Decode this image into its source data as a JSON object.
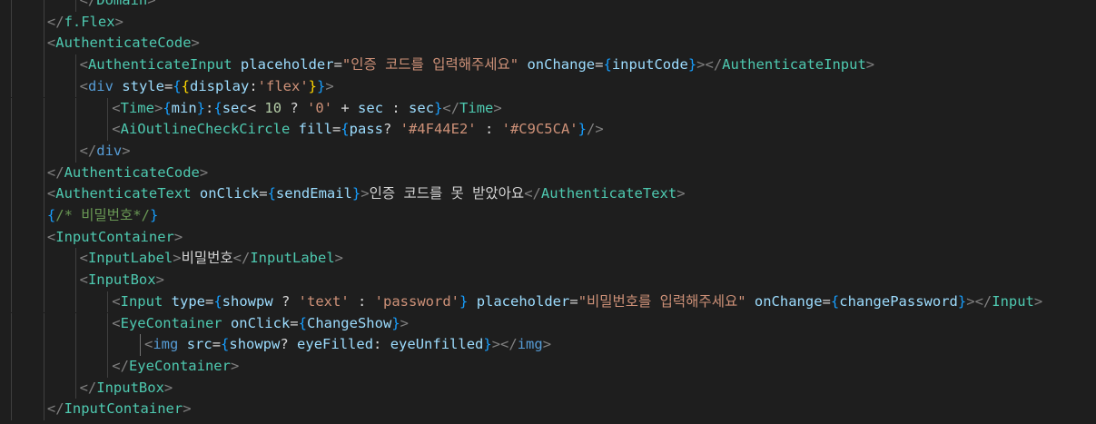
{
  "editor": {
    "language": "jsx",
    "lines": [
      {
        "indent": 3,
        "tokens": [
          {
            "c": "t-tag",
            "t": "</"
          },
          {
            "c": "t-comp",
            "t": "Domain"
          },
          {
            "c": "t-tag",
            "t": ">"
          }
        ]
      },
      {
        "indent": 2,
        "tokens": [
          {
            "c": "t-tag",
            "t": "</"
          },
          {
            "c": "t-comp",
            "t": "f.Flex"
          },
          {
            "c": "t-tag",
            "t": ">"
          }
        ]
      },
      {
        "indent": 2,
        "tokens": [
          {
            "c": "t-tag",
            "t": "<"
          },
          {
            "c": "t-comp",
            "t": "AuthenticateCode"
          },
          {
            "c": "t-tag",
            "t": ">"
          }
        ]
      },
      {
        "indent": 3,
        "tokens": [
          {
            "c": "t-tag",
            "t": "<"
          },
          {
            "c": "t-comp",
            "t": "AuthenticateInput"
          },
          {
            "c": "t-op",
            "t": " "
          },
          {
            "c": "t-attr",
            "t": "placeholder"
          },
          {
            "c": "t-op",
            "t": "="
          },
          {
            "c": "t-str",
            "t": "\"인증 코드를 입력해주세요\""
          },
          {
            "c": "t-op",
            "t": " "
          },
          {
            "c": "t-attr",
            "t": "onChange"
          },
          {
            "c": "t-op",
            "t": "="
          },
          {
            "c": "t-brace",
            "t": "{"
          },
          {
            "c": "t-var",
            "t": "inputCode"
          },
          {
            "c": "t-brace",
            "t": "}"
          },
          {
            "c": "t-tag",
            "t": "></"
          },
          {
            "c": "t-comp",
            "t": "AuthenticateInput"
          },
          {
            "c": "t-tag",
            "t": ">"
          }
        ]
      },
      {
        "indent": 3,
        "tokens": [
          {
            "c": "t-tag",
            "t": "<"
          },
          {
            "c": "t-html",
            "t": "div"
          },
          {
            "c": "t-op",
            "t": " "
          },
          {
            "c": "t-attr",
            "t": "style"
          },
          {
            "c": "t-op",
            "t": "="
          },
          {
            "c": "t-brace",
            "t": "{"
          },
          {
            "c": "t-brace3",
            "t": "{"
          },
          {
            "c": "t-attr",
            "t": "display"
          },
          {
            "c": "t-op",
            "t": ":"
          },
          {
            "c": "t-str",
            "t": "'flex'"
          },
          {
            "c": "t-brace3",
            "t": "}"
          },
          {
            "c": "t-brace",
            "t": "}"
          },
          {
            "c": "t-tag",
            "t": ">"
          }
        ]
      },
      {
        "indent": 4,
        "tokens": [
          {
            "c": "t-tag",
            "t": "<"
          },
          {
            "c": "t-comp",
            "t": "Time"
          },
          {
            "c": "t-tag",
            "t": ">"
          },
          {
            "c": "t-brace",
            "t": "{"
          },
          {
            "c": "t-var",
            "t": "min"
          },
          {
            "c": "t-brace",
            "t": "}"
          },
          {
            "c": "t-text",
            "t": ":"
          },
          {
            "c": "t-brace",
            "t": "{"
          },
          {
            "c": "t-var",
            "t": "sec"
          },
          {
            "c": "t-op",
            "t": "< "
          },
          {
            "c": "t-num",
            "t": "10"
          },
          {
            "c": "t-op",
            "t": " ? "
          },
          {
            "c": "t-str",
            "t": "'0'"
          },
          {
            "c": "t-op",
            "t": " + "
          },
          {
            "c": "t-var",
            "t": "sec"
          },
          {
            "c": "t-op",
            "t": " : "
          },
          {
            "c": "t-var",
            "t": "sec"
          },
          {
            "c": "t-brace",
            "t": "}"
          },
          {
            "c": "t-tag",
            "t": "</"
          },
          {
            "c": "t-comp",
            "t": "Time"
          },
          {
            "c": "t-tag",
            "t": ">"
          }
        ]
      },
      {
        "indent": 4,
        "tokens": [
          {
            "c": "t-tag",
            "t": "<"
          },
          {
            "c": "t-comp",
            "t": "AiOutlineCheckCircle"
          },
          {
            "c": "t-op",
            "t": " "
          },
          {
            "c": "t-attr",
            "t": "fill"
          },
          {
            "c": "t-op",
            "t": "="
          },
          {
            "c": "t-brace",
            "t": "{"
          },
          {
            "c": "t-var",
            "t": "pass"
          },
          {
            "c": "t-op",
            "t": "? "
          },
          {
            "c": "t-str",
            "t": "'#4F44E2'"
          },
          {
            "c": "t-op",
            "t": " : "
          },
          {
            "c": "t-str",
            "t": "'#C9C5CA'"
          },
          {
            "c": "t-brace",
            "t": "}"
          },
          {
            "c": "t-tag",
            "t": "/>"
          }
        ]
      },
      {
        "indent": 3,
        "tokens": [
          {
            "c": "t-tag",
            "t": "</"
          },
          {
            "c": "t-html",
            "t": "div"
          },
          {
            "c": "t-tag",
            "t": ">"
          }
        ]
      },
      {
        "indent": 2,
        "tokens": [
          {
            "c": "t-tag",
            "t": "</"
          },
          {
            "c": "t-comp",
            "t": "AuthenticateCode"
          },
          {
            "c": "t-tag",
            "t": ">"
          }
        ]
      },
      {
        "indent": 2,
        "tokens": [
          {
            "c": "t-tag",
            "t": "<"
          },
          {
            "c": "t-comp",
            "t": "AuthenticateText"
          },
          {
            "c": "t-op",
            "t": " "
          },
          {
            "c": "t-attr",
            "t": "onClick"
          },
          {
            "c": "t-op",
            "t": "="
          },
          {
            "c": "t-brace",
            "t": "{"
          },
          {
            "c": "t-var",
            "t": "sendEmail"
          },
          {
            "c": "t-brace",
            "t": "}"
          },
          {
            "c": "t-tag",
            "t": ">"
          },
          {
            "c": "t-text",
            "t": "인증 코드를 못 받았아요"
          },
          {
            "c": "t-tag",
            "t": "</"
          },
          {
            "c": "t-comp",
            "t": "AuthenticateText"
          },
          {
            "c": "t-tag",
            "t": ">"
          }
        ]
      },
      {
        "indent": 2,
        "tokens": [
          {
            "c": "t-brace",
            "t": "{"
          },
          {
            "c": "t-comment",
            "t": "/* 비밀번호*/"
          },
          {
            "c": "t-brace",
            "t": "}"
          }
        ]
      },
      {
        "indent": 2,
        "tokens": [
          {
            "c": "t-tag",
            "t": "<"
          },
          {
            "c": "t-comp",
            "t": "InputContainer"
          },
          {
            "c": "t-tag",
            "t": ">"
          }
        ]
      },
      {
        "indent": 3,
        "tokens": [
          {
            "c": "t-tag",
            "t": "<"
          },
          {
            "c": "t-comp",
            "t": "InputLabel"
          },
          {
            "c": "t-tag",
            "t": ">"
          },
          {
            "c": "t-text",
            "t": "비밀번호"
          },
          {
            "c": "t-tag",
            "t": "</"
          },
          {
            "c": "t-comp",
            "t": "InputLabel"
          },
          {
            "c": "t-tag",
            "t": ">"
          }
        ]
      },
      {
        "indent": 3,
        "tokens": [
          {
            "c": "t-tag",
            "t": "<"
          },
          {
            "c": "t-comp",
            "t": "InputBox"
          },
          {
            "c": "t-tag",
            "t": ">"
          }
        ]
      },
      {
        "indent": 4,
        "tokens": [
          {
            "c": "t-tag",
            "t": "<"
          },
          {
            "c": "t-comp",
            "t": "Input"
          },
          {
            "c": "t-op",
            "t": " "
          },
          {
            "c": "t-attr",
            "t": "type"
          },
          {
            "c": "t-op",
            "t": "="
          },
          {
            "c": "t-brace",
            "t": "{"
          },
          {
            "c": "t-var",
            "t": "showpw"
          },
          {
            "c": "t-op",
            "t": " ? "
          },
          {
            "c": "t-str",
            "t": "'text'"
          },
          {
            "c": "t-op",
            "t": " : "
          },
          {
            "c": "t-str",
            "t": "'password'"
          },
          {
            "c": "t-brace",
            "t": "}"
          },
          {
            "c": "t-op",
            "t": " "
          },
          {
            "c": "t-attr",
            "t": "placeholder"
          },
          {
            "c": "t-op",
            "t": "="
          },
          {
            "c": "t-str",
            "t": "\"비밀번호를 입력해주세요\""
          },
          {
            "c": "t-op",
            "t": " "
          },
          {
            "c": "t-attr",
            "t": "onChange"
          },
          {
            "c": "t-op",
            "t": "="
          },
          {
            "c": "t-brace",
            "t": "{"
          },
          {
            "c": "t-var",
            "t": "changePassword"
          },
          {
            "c": "t-brace",
            "t": "}"
          },
          {
            "c": "t-tag",
            "t": "></"
          },
          {
            "c": "t-comp",
            "t": "Input"
          },
          {
            "c": "t-tag",
            "t": ">"
          }
        ]
      },
      {
        "indent": 4,
        "tokens": [
          {
            "c": "t-tag",
            "t": "<"
          },
          {
            "c": "t-comp",
            "t": "EyeContainer"
          },
          {
            "c": "t-op",
            "t": " "
          },
          {
            "c": "t-attr",
            "t": "onClick"
          },
          {
            "c": "t-op",
            "t": "="
          },
          {
            "c": "t-brace",
            "t": "{"
          },
          {
            "c": "t-var",
            "t": "ChangeShow"
          },
          {
            "c": "t-brace",
            "t": "}"
          },
          {
            "c": "t-tag",
            "t": ">"
          }
        ]
      },
      {
        "indent": 5,
        "tokens": [
          {
            "c": "t-tag",
            "t": "<"
          },
          {
            "c": "t-html",
            "t": "img"
          },
          {
            "c": "t-op",
            "t": " "
          },
          {
            "c": "t-attr",
            "t": "src"
          },
          {
            "c": "t-op",
            "t": "="
          },
          {
            "c": "t-brace",
            "t": "{"
          },
          {
            "c": "t-var",
            "t": "showpw"
          },
          {
            "c": "t-op",
            "t": "? "
          },
          {
            "c": "t-var",
            "t": "eyeFilled"
          },
          {
            "c": "t-op",
            "t": ": "
          },
          {
            "c": "t-var",
            "t": "eyeUnfilled"
          },
          {
            "c": "t-brace",
            "t": "}"
          },
          {
            "c": "t-tag",
            "t": "></"
          },
          {
            "c": "t-html",
            "t": "img"
          },
          {
            "c": "t-tag",
            "t": ">"
          }
        ]
      },
      {
        "indent": 4,
        "tokens": [
          {
            "c": "t-tag",
            "t": "</"
          },
          {
            "c": "t-comp",
            "t": "EyeContainer"
          },
          {
            "c": "t-tag",
            "t": ">"
          }
        ]
      },
      {
        "indent": 3,
        "tokens": [
          {
            "c": "t-tag",
            "t": "</"
          },
          {
            "c": "t-comp",
            "t": "InputBox"
          },
          {
            "c": "t-tag",
            "t": ">"
          }
        ]
      },
      {
        "indent": 2,
        "tokens": [
          {
            "c": "t-tag",
            "t": "</"
          },
          {
            "c": "t-comp",
            "t": "InputContainer"
          },
          {
            "c": "t-tag",
            "t": ">"
          }
        ]
      }
    ]
  }
}
